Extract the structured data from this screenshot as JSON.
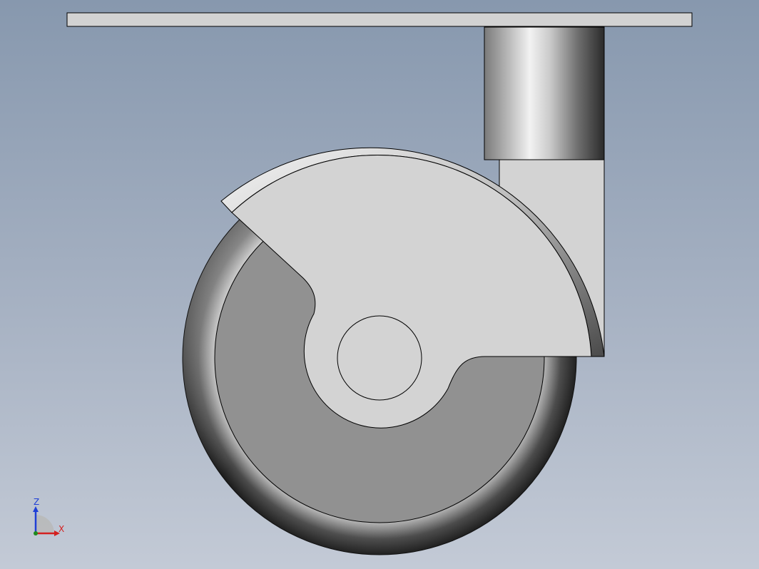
{
  "view": {
    "background_top": "#8798ae",
    "background_bottom": "#c3cad6"
  },
  "triad": {
    "z_label": "Z",
    "x_label": "X",
    "z_color": "#1f3fd6",
    "x_color": "#d42020",
    "y_color": "#1e8a1e"
  },
  "model": {
    "name": "caster-wheel",
    "colors": {
      "plate": "#d2d2d2",
      "bracket": "#d3d3d3",
      "hub": "#919191",
      "outline": "#000000"
    }
  }
}
